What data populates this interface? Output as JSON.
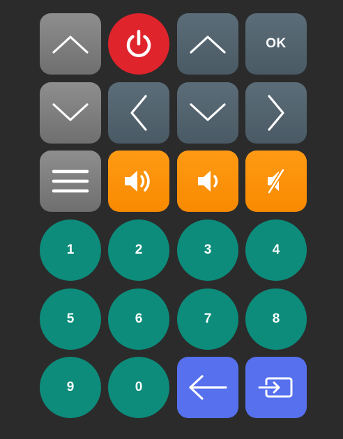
{
  "nav": {
    "ok_label": "OK"
  },
  "numpad": {
    "keys": [
      "1",
      "2",
      "3",
      "4",
      "5",
      "6",
      "7",
      "8",
      "9",
      "0"
    ]
  },
  "colors": {
    "background": "#2b2b2b",
    "gray": "#7d7d7d",
    "slate": "#53636e",
    "power_red": "#e0242c",
    "volume_orange": "#fb8e00",
    "number_teal": "#0d8c7b",
    "action_blue": "#5670ee"
  },
  "icons": {
    "channel_up": "chevron-up-icon",
    "power": "power-icon",
    "dpad_up": "chevron-up-icon",
    "channel_down": "chevron-down-icon",
    "dpad_left": "chevron-left-icon",
    "dpad_down": "chevron-down-icon",
    "dpad_right": "chevron-right-icon",
    "menu": "hamburger-menu-icon",
    "volume_up": "volume-up-icon",
    "volume_down": "volume-down-icon",
    "mute": "mute-icon",
    "back": "back-arrow-icon",
    "input": "input-source-icon"
  }
}
